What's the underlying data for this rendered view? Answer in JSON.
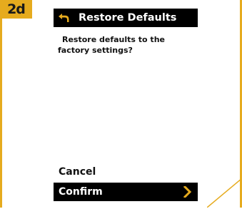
{
  "step_badge": "2d",
  "screen": {
    "title": "Restore Defaults",
    "message": "Restore defaults to the factory settings?",
    "menu": {
      "cancel_label": "Cancel",
      "confirm_label": "Confirm"
    }
  },
  "colors": {
    "accent": "#e6ab1e",
    "title_bar": "#000000",
    "selected_item": "#000000"
  },
  "icons": {
    "back": "back-arrow-icon",
    "confirm_chevron": "chevron-right-icon"
  }
}
